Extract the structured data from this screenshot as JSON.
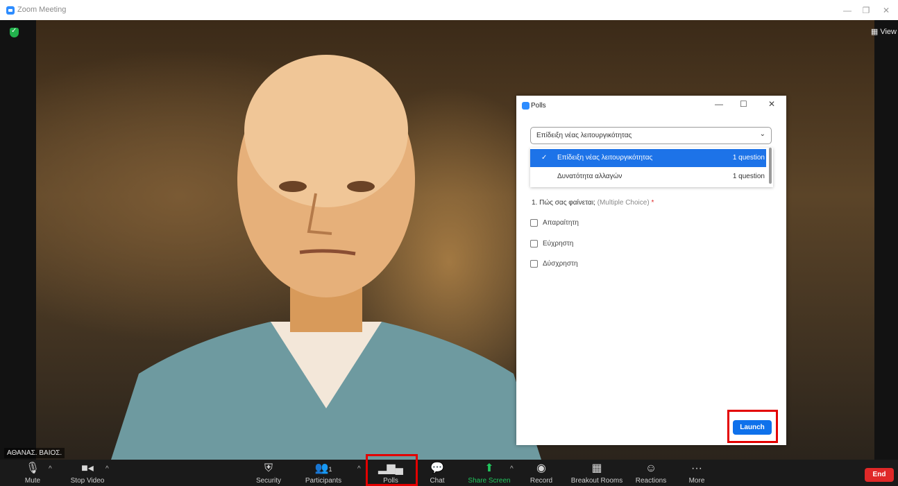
{
  "window": {
    "title": "Zoom Meeting",
    "minimize": "—",
    "restore": "❐",
    "close": "✕"
  },
  "video": {
    "view_label": "View",
    "participant_name": "ΑΘΑΝΑΣ. ΒΑΙΟΣ."
  },
  "toolbar": {
    "mute": "Mute",
    "stop_video": "Stop Video",
    "security": "Security",
    "participants": "Participants",
    "participants_count": "1",
    "polls": "Polls",
    "chat": "Chat",
    "share_screen": "Share Screen",
    "record": "Record",
    "breakout_rooms": "Breakout Rooms",
    "reactions": "Reactions",
    "more": "More",
    "end": "End"
  },
  "polls": {
    "title": "Polls",
    "selected_poll": "Επίδειξη νέας λειτουργικότητας",
    "options": [
      {
        "name": "Επίδειξη νέας λειτουργικότητας",
        "count": "1 question",
        "selected": true
      },
      {
        "name": "Δυνατότητα αλλαγών",
        "count": "1 question",
        "selected": false
      }
    ],
    "question": {
      "text": "1. Πώς σας φαίνεται;",
      "type": "(Multiple Choice)",
      "required_mark": "*"
    },
    "choices": [
      "Απαραίτητη",
      "Εύχρηστη",
      "Δύσχρηστη"
    ],
    "launch": "Launch"
  },
  "colors": {
    "accent": "#0e71eb",
    "highlight": "#e30000",
    "end": "#e02828",
    "share": "#21c55d"
  }
}
